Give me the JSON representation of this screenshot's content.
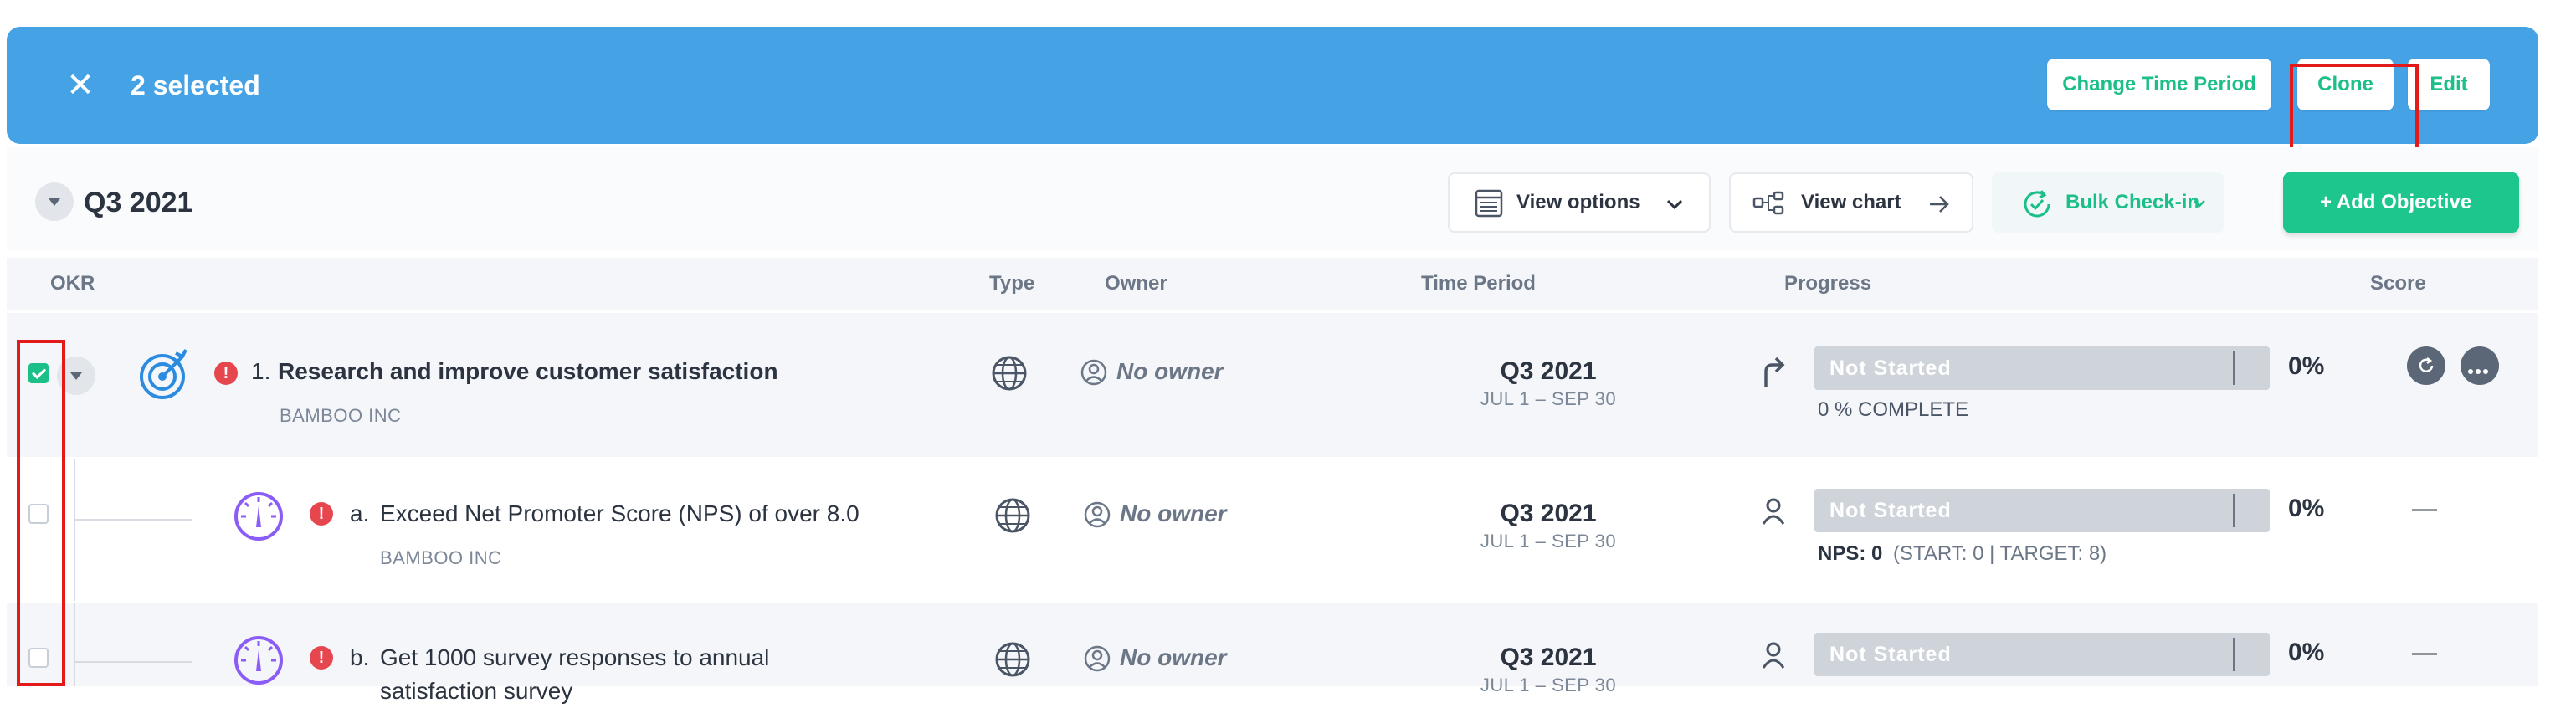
{
  "selection_bar": {
    "count_label": "2 selected",
    "close_icon": "close-icon",
    "actions": {
      "change_time_period": "Change Time Period",
      "clone": "Clone",
      "edit": "Edit"
    }
  },
  "toolbar": {
    "period_title": "Q3 2021",
    "view_options": "View options",
    "view_chart": "View chart",
    "bulk_checkin": "Bulk Check-in",
    "add_objective": "+ Add Objective"
  },
  "table": {
    "headers": {
      "okr": "OKR",
      "type": "Type",
      "owner": "Owner",
      "time_period": "Time Period",
      "progress": "Progress",
      "score": "Score"
    },
    "rows": [
      {
        "checked": true,
        "number": "1.",
        "title": "Research and improve customer satisfaction",
        "company": "BAMBOO INC",
        "owner": "No owner",
        "period": "Q3 2021",
        "period_range": "JUL 1 – SEP 30",
        "status": "Not Started",
        "progress_fraction": 0,
        "percent": "0%",
        "progress_note": "0  % COMPLETE",
        "score": ""
      },
      {
        "checked": false,
        "number": "a.",
        "title": "Exceed Net Promoter Score (NPS) of over 8.0",
        "company": "BAMBOO INC",
        "owner": "No owner",
        "period": "Q3 2021",
        "period_range": "JUL 1 – SEP 30",
        "status": "Not Started",
        "progress_fraction": 0,
        "percent": "0%",
        "metric_label": "NPS: 0",
        "metric_detail": "(START: 0 | TARGET: 8)",
        "score": "—"
      },
      {
        "checked": false,
        "number": "b.",
        "title": "Get 1000 survey responses to annual",
        "title_cont": "satisfaction survey",
        "owner": "No owner",
        "period": "Q3 2021",
        "period_range": "JUL 1 – SEP 30",
        "status": "Not Started",
        "progress_fraction": 0,
        "percent": "0%",
        "score": "—"
      }
    ]
  },
  "colors": {
    "banner": "#45a3e5",
    "accent_green": "#1dc68d",
    "alert_red": "#e6474f",
    "kr_purple": "#8b5cf6",
    "objective_blue": "#2a8be0",
    "highlight_red": "#e21a1a"
  }
}
